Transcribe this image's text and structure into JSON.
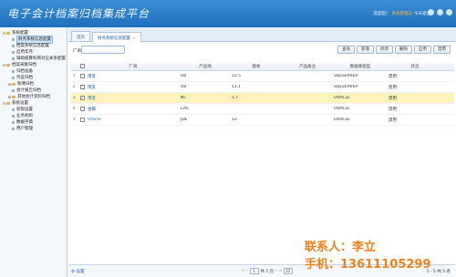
{
  "app": {
    "title": "电子会计档案归档集成平台"
  },
  "userbar": {
    "welcome": "欢迎您！",
    "username": "系统管理员",
    "logout": "今天退出"
  },
  "sidebar": {
    "items": [
      {
        "label": "系统配置",
        "level": 0,
        "kind": "folder",
        "toggle": "⊟"
      },
      {
        "label": "财务系统信息配置",
        "level": 1,
        "kind": "leaf",
        "selected": true
      },
      {
        "label": "档案系统信息配置",
        "level": 1,
        "kind": "leaf"
      },
      {
        "label": "启用年月",
        "level": 1,
        "kind": "leaf"
      },
      {
        "label": "辅助核算科目对应关系配置",
        "level": 1,
        "kind": "leaf"
      },
      {
        "label": "档案采集归档",
        "level": 0,
        "kind": "folder",
        "toggle": "⊟"
      },
      {
        "label": "归档准备",
        "level": 1,
        "kind": "leaf"
      },
      {
        "label": "凭证归档",
        "level": 1,
        "kind": "leaf"
      },
      {
        "label": "账簿归档",
        "level": 1,
        "kind": "folder",
        "toggle": "⊞"
      },
      {
        "label": "会计报告归档",
        "level": 1,
        "kind": "leaf"
      },
      {
        "label": "其他会计资料归档",
        "level": 1,
        "kind": "folder",
        "toggle": "⊞"
      },
      {
        "label": "系统设置",
        "level": 0,
        "kind": "folder",
        "toggle": "⊟"
      },
      {
        "label": "权限设置",
        "level": 1,
        "kind": "leaf"
      },
      {
        "label": "业务机构",
        "level": 1,
        "kind": "leaf"
      },
      {
        "label": "数据字典",
        "level": 1,
        "kind": "leaf"
      },
      {
        "label": "用户管理",
        "level": 1,
        "kind": "leaf"
      }
    ]
  },
  "tabs": [
    {
      "label": "首页",
      "active": false,
      "closable": false
    },
    {
      "label": "财务系统信息配置",
      "active": true,
      "closable": true
    }
  ],
  "toolbar": {
    "search_label": "厂商",
    "search_value": "",
    "buttons": [
      "查询",
      "新增",
      "修改",
      "删除",
      "启用",
      "禁用"
    ]
  },
  "table": {
    "columns": [
      "厂商",
      "产品线",
      "版本",
      "产品备注",
      "数据库类型",
      "状态"
    ],
    "rows": [
      {
        "num": "1",
        "vendor": "用友",
        "product": "U8",
        "version": "12.5",
        "note": "",
        "db": "SQLSERVER",
        "status": "禁用",
        "selected": false
      },
      {
        "num": "2",
        "vendor": "用友",
        "product": "U8",
        "version": "11.1",
        "note": "",
        "db": "SQLSERVER",
        "status": "禁用",
        "selected": false
      },
      {
        "num": "3",
        "vendor": "用友",
        "product": "NC",
        "version": "5.7",
        "note": "",
        "db": "ORACLE",
        "status": "禁用",
        "selected": true
      },
      {
        "num": "4",
        "vendor": "金蝶",
        "product": "EAS",
        "version": "",
        "note": "",
        "db": "ORACLE",
        "status": "禁用",
        "selected": false
      },
      {
        "num": "5",
        "vendor": "Oracle",
        "product": "JDE",
        "version": "12",
        "note": "",
        "db": "ORACLE",
        "status": "禁用",
        "selected": false
      }
    ]
  },
  "footer": {
    "settings_label": "设置",
    "pager_first": "«",
    "pager_prev": "‹",
    "page_value": "1",
    "page_total_text": "共 1 页",
    "pager_next": "›",
    "pager_last": "»",
    "page_size": "15",
    "range_text": "1 - 5 共 5 条"
  },
  "contact": {
    "line1": "联系人：李立",
    "line2": "手机：13611105299"
  },
  "colors": {
    "header": "#1f6fbf",
    "accent": "#f0801a",
    "selected_row": "#fdf2b9",
    "link": "#1a5fb4"
  }
}
